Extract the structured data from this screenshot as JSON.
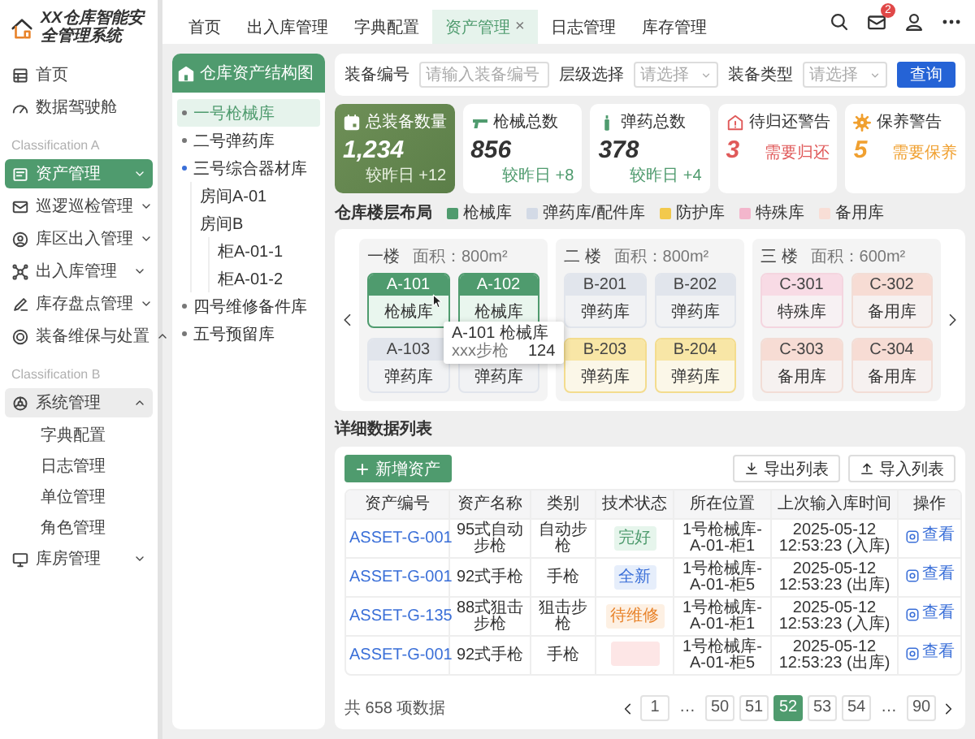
{
  "sidebar": {
    "title": "XX仓库智能安全管理系统",
    "items": [
      {
        "kind": "item",
        "label": "首页",
        "selected": false
      },
      {
        "kind": "item",
        "label": "数据驾驶舱",
        "selected": false
      },
      {
        "kind": "section",
        "label": "Classification A"
      },
      {
        "kind": "group",
        "label": "资产管理",
        "selected": true,
        "expanded": false,
        "hovered": false
      },
      {
        "kind": "group",
        "label": "巡逻巡检管理",
        "selected": false,
        "expanded": false,
        "hovered": false
      },
      {
        "kind": "group",
        "label": "库区出入管理",
        "selected": false,
        "expanded": false,
        "hovered": false
      },
      {
        "kind": "group",
        "label": "出入库管理",
        "selected": false,
        "expanded": false,
        "hovered": false
      },
      {
        "kind": "group",
        "label": "库存盘点管理",
        "selected": false,
        "expanded": false,
        "hovered": false
      },
      {
        "kind": "group",
        "label": "装备维保与处置",
        "selected": false,
        "expanded": true,
        "hovered": false
      },
      {
        "kind": "section",
        "label": "Classification B"
      },
      {
        "kind": "group",
        "label": "系统管理",
        "selected": false,
        "expanded": true,
        "hovered": true,
        "children": [
          {
            "label": "字典配置",
            "selected": false
          },
          {
            "label": "日志管理",
            "selected": false
          },
          {
            "label": "单位管理",
            "selected": false
          },
          {
            "label": "角色管理",
            "selected": false
          }
        ]
      },
      {
        "kind": "group",
        "label": "库房管理",
        "selected": false,
        "expanded": false,
        "hovered": false
      }
    ]
  },
  "topbar": {
    "tabs": [
      {
        "label": "首页",
        "selected": false
      },
      {
        "label": "出入库管理",
        "selected": false
      },
      {
        "label": "字典配置",
        "selected": false
      },
      {
        "label": "资产管理",
        "selected": true,
        "close": "×"
      },
      {
        "label": "日志管理",
        "selected": false
      },
      {
        "label": "库存管理",
        "selected": false
      }
    ],
    "notifications": "2"
  },
  "tree": {
    "title": "仓库资产结构图",
    "nodes": [
      {
        "label": "一号枪械库",
        "selected": true,
        "expanded": false
      },
      {
        "label": "二号弹药库",
        "selected": false,
        "expanded": false
      },
      {
        "label": "三号综合器材库",
        "selected": false,
        "expanded": true,
        "children": [
          {
            "label": "房间A-01",
            "selected": false
          },
          {
            "label": "房间B",
            "selected": false,
            "children": [
              {
                "label": "柜A-01-1",
                "selected": false
              },
              {
                "label": "柜A-01-2",
                "selected": false
              }
            ]
          }
        ]
      },
      {
        "label": "四号维修备件库",
        "selected": false,
        "expanded": false
      },
      {
        "label": "五号预留库",
        "selected": false,
        "expanded": false
      }
    ]
  },
  "filter": {
    "fields": [
      {
        "kind": "input",
        "label": "装备编号",
        "placeholder": "请输入装备编号"
      },
      {
        "kind": "select",
        "label": "层级选择",
        "placeholder": "请选择"
      },
      {
        "kind": "select",
        "label": "装备类型",
        "placeholder": "请选择"
      }
    ],
    "button": "查询"
  },
  "stats": [
    {
      "kind": "primary",
      "label": "总装备数量",
      "value": "1,234",
      "note": "较昨日 +12"
    },
    {
      "kind": "normal",
      "label": "枪械总数",
      "value": "856",
      "note": "较昨日 +8"
    },
    {
      "kind": "normal",
      "label": "弹药总数",
      "value": "378",
      "note": "较昨日 +4"
    },
    {
      "kind": "danger",
      "label": "待归还警告",
      "value": "3",
      "note": "需要归还"
    },
    {
      "kind": "warning",
      "label": "保养警告",
      "value": "5",
      "note": "需要保养"
    }
  ],
  "layout": {
    "title": "仓库楼层布局",
    "legend": [
      {
        "label": "枪械库",
        "color": "#4f9b6e"
      },
      {
        "label": "弹药库/配件库",
        "color": "#d3dae6"
      },
      {
        "label": "防护库",
        "color": "#f2c94c"
      },
      {
        "label": "特殊库",
        "color": "#f3b6cc"
      },
      {
        "label": "备用库",
        "color": "#f8ded6"
      }
    ],
    "floors": [
      {
        "name": "一楼",
        "area": "面积：800m²",
        "rooms": [
          {
            "code": "A-101",
            "type": "枪械库",
            "kind": "armory"
          },
          {
            "code": "A-102",
            "type": "枪械库",
            "kind": "armory"
          },
          {
            "code": "A-103",
            "type": "弹药库",
            "kind": "ammo"
          },
          {
            "type": "弹药库",
            "kind": "ammo"
          }
        ]
      },
      {
        "name": "二 楼",
        "area": "面积：800m²",
        "rooms": [
          {
            "code": "B-201",
            "type": "弹药库",
            "kind": "ammo"
          },
          {
            "code": "B-202",
            "type": "弹药库",
            "kind": "ammo"
          },
          {
            "code": "B-203",
            "type": "弹药库",
            "kind": "protection"
          },
          {
            "code": "B-204",
            "type": "弹药库",
            "kind": "protection"
          }
        ]
      },
      {
        "name": "三 楼",
        "area": "面积：600m²",
        "rooms": [
          {
            "code": "C-301",
            "type": "特殊库",
            "kind": "special"
          },
          {
            "code": "C-302",
            "type": "备用库",
            "kind": "spare"
          },
          {
            "code": "C-303",
            "type": "备用库",
            "kind": "spare"
          },
          {
            "code": "C-304",
            "type": "备用库",
            "kind": "spare"
          }
        ]
      }
    ],
    "tooltip": {
      "title": "A-101 枪械库",
      "name": "xxx步枪",
      "count": "124"
    }
  },
  "table": {
    "title": "详细数据列表",
    "add_button": "新增资产",
    "export_button": "导出列表",
    "import_button": "导入列表",
    "columns": [
      "资产编号",
      "资产名称",
      "类别",
      "技术状态",
      "所在位置",
      "上次输入库时间",
      "操作"
    ],
    "rows": [
      {
        "id": "ASSET-G-001",
        "name": "95式自动步枪",
        "category": "自动步枪",
        "status": {
          "kind": "good",
          "label": "完好"
        },
        "location": "1号枪械库-A-01-柜1",
        "time": "2025-05-12 12:53:23 (入库)",
        "action": "查看"
      },
      {
        "id": "ASSET-G-001",
        "name": "92式手枪",
        "category": "手枪",
        "status": {
          "kind": "new",
          "label": "全新"
        },
        "location": "1号枪械库-A-01-柜5",
        "time": "2025-05-12 12:53:23 (出库)",
        "action": "查看"
      },
      {
        "id": "ASSET-G-135",
        "name": "88式狙击步枪",
        "category": "狙击步枪",
        "status": {
          "kind": "repair",
          "label": "待维修"
        },
        "location": "1号枪械库-A-01-柜1",
        "time": "2025-05-12 12:53:23 (入库)",
        "action": "查看"
      },
      {
        "id": "ASSET-G-001",
        "name": "92式手枪",
        "category": "手枪",
        "status": {
          "kind": "danger"
        },
        "location": "1号枪械库-A-01-柜5",
        "time": "2025-05-12 12:53:23 (出库)",
        "action": "查看"
      }
    ],
    "total": "共 658 项数据",
    "pages": [
      {
        "label": "1",
        "selected": false
      },
      {
        "label": "…",
        "selected": false
      },
      {
        "label": "50",
        "selected": false
      },
      {
        "label": "51",
        "selected": false
      },
      {
        "label": "52",
        "selected": true
      },
      {
        "label": "53",
        "selected": false
      },
      {
        "label": "54",
        "selected": false
      },
      {
        "label": "…",
        "selected": false
      },
      {
        "label": "90",
        "selected": false
      }
    ]
  }
}
